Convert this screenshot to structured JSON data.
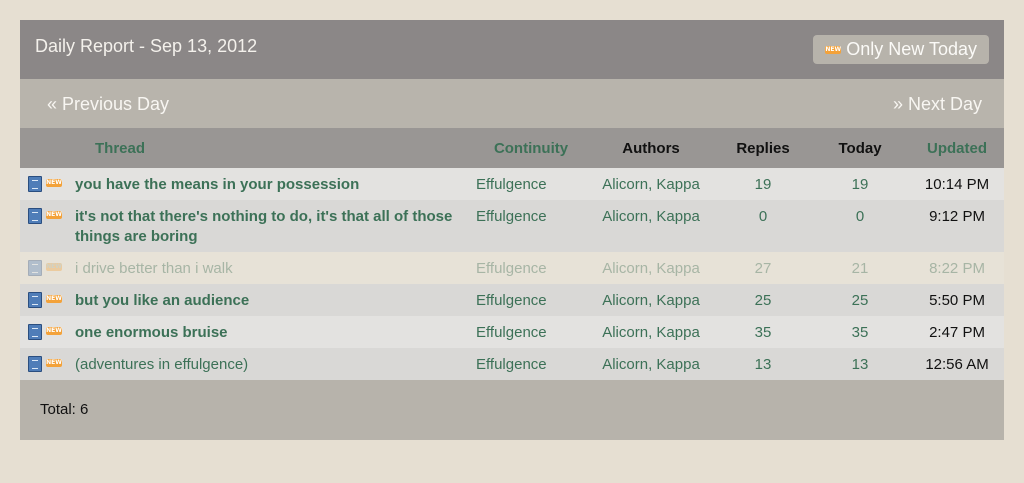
{
  "header": {
    "title": "Daily Report - Sep 13, 2012",
    "only_new_label": "Only New Today",
    "new_badge": "NEW"
  },
  "nav": {
    "prev_label": "« Previous Day",
    "next_label": "» Next Day"
  },
  "table": {
    "columns": [
      "Thread",
      "Continuity",
      "Authors",
      "Replies",
      "Today",
      "Updated"
    ],
    "rows": [
      {
        "subject": "you have the means in your possession",
        "continuity": "Effulgence",
        "author1": "Alicorn",
        "author2": "Kappa",
        "replies": "19",
        "today": "19",
        "updated": "10:14 PM"
      },
      {
        "subject": "it's not that there's nothing to do, it's that all of those things are boring",
        "continuity": "Effulgence",
        "author1": "Alicorn",
        "author2": "Kappa",
        "replies": "0",
        "today": "0",
        "updated": "9:12 PM"
      },
      {
        "subject": "i drive better than i walk",
        "continuity": "Effulgence",
        "author1": "Alicorn",
        "author2": "Kappa",
        "replies": "27",
        "today": "21",
        "updated": "8:22 PM"
      },
      {
        "subject": "but you like an audience",
        "continuity": "Effulgence",
        "author1": "Alicorn",
        "author2": "Kappa",
        "replies": "25",
        "today": "25",
        "updated": "5:50 PM"
      },
      {
        "subject": "one enormous bruise",
        "continuity": "Effulgence",
        "author1": "Alicorn",
        "author2": "Kappa",
        "replies": "35",
        "today": "35",
        "updated": "2:47 PM"
      },
      {
        "subject": "(adventures in effulgence)",
        "continuity": "Effulgence",
        "author1": "Alicorn",
        "author2": "Kappa",
        "replies": "13",
        "today": "13",
        "updated": "12:56 AM"
      }
    ]
  },
  "footer": {
    "total_label": "Total:",
    "total_value": "6"
  },
  "colors": {
    "background": "#e6dfd2",
    "header": "#8b8787",
    "link_green": "#3c7157",
    "new_badge": "#f3a23a"
  },
  "icons": [
    "book-icon",
    "new-icon"
  ]
}
